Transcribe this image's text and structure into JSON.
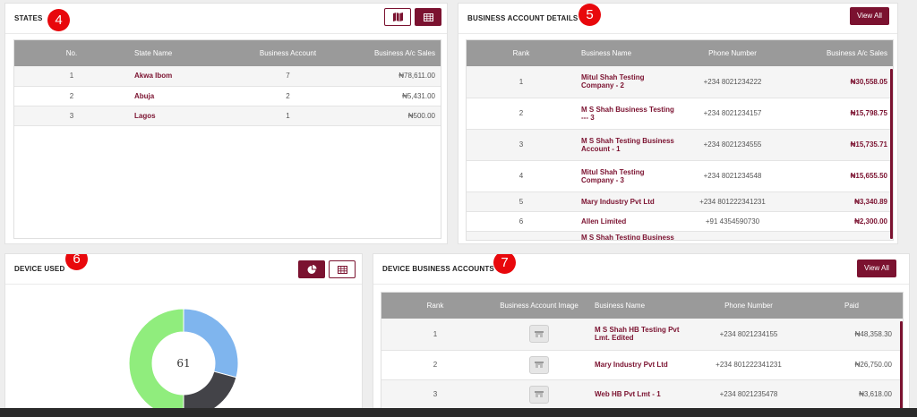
{
  "states": {
    "title": "STATES",
    "badge": "4",
    "icons": {
      "map": "map-icon",
      "table": "table-icon"
    },
    "columns": [
      "No.",
      "State Name",
      "Business Account",
      "Business A/c Sales"
    ],
    "rows": [
      {
        "no": "1",
        "name": "Akwa Ibom",
        "accounts": "7",
        "sales": "₦78,611.00"
      },
      {
        "no": "2",
        "name": "Abuja",
        "accounts": "2",
        "sales": "₦5,431.00"
      },
      {
        "no": "3",
        "name": "Lagos",
        "accounts": "1",
        "sales": "₦500.00"
      }
    ]
  },
  "business_details": {
    "title": "BUSINESS ACCOUNT DETAILS",
    "badge": "5",
    "view_all": "View All",
    "columns": [
      "Rank",
      "Business Name",
      "Phone Number",
      "Business A/c Sales"
    ],
    "rows": [
      {
        "rank": "1",
        "name": "Mitul Shah Testing Company - 2",
        "phone": "+234 8021234222",
        "sales": "₦30,558.05"
      },
      {
        "rank": "2",
        "name": "M S Shah Business Testing --- 3",
        "phone": "+234 8021234157",
        "sales": "₦15,798.75"
      },
      {
        "rank": "3",
        "name": "M S Shah Testing Business Account - 1",
        "phone": "+234 8021234555",
        "sales": "₦15,735.71"
      },
      {
        "rank": "4",
        "name": "Mitul Shah Testing Company - 3",
        "phone": "+234 8021234548",
        "sales": "₦15,655.50"
      },
      {
        "rank": "5",
        "name": "Mary Industry Pvt Ltd",
        "phone": "+234 801222341231",
        "sales": "₦3,340.89"
      },
      {
        "rank": "6",
        "name": "Allen Limited",
        "phone": "+91 4354590730",
        "sales": "₦2,300.00"
      },
      {
        "rank": "",
        "name": "M S Shah Testing Business",
        "phone": "",
        "sales": ""
      }
    ]
  },
  "device_used": {
    "title": "DEVICE USED",
    "badge": "6",
    "icons": {
      "chart": "pie-chart-icon",
      "table": "table-icon"
    },
    "center_value": "61",
    "colors": {
      "blue": "#7fb5ee",
      "dark": "#434348",
      "green": "#90ed7d"
    }
  },
  "device_accounts": {
    "title": "DEVICE BUSINESS ACCOUNTS",
    "badge": "7",
    "view_all": "View All",
    "columns": [
      "Rank",
      "Business Account Image",
      "Business Name",
      "Phone Number",
      "Paid"
    ],
    "rows": [
      {
        "rank": "1",
        "image": "store-icon",
        "name": "M S Shah HB Testing Pvt Lmt. Edited",
        "phone": "+234 8021234155",
        "paid": "₦48,358.30"
      },
      {
        "rank": "2",
        "image": "store-icon",
        "name": "Mary Industry Pvt Ltd",
        "phone": "+234 801222341231",
        "paid": "₦26,750.00"
      },
      {
        "rank": "3",
        "image": "store-icon",
        "name": "Web HB Pvt Lmt - 1",
        "phone": "+234 8021235478",
        "paid": "₦3,618.00"
      }
    ]
  },
  "theme": {
    "accent": "#7b1230",
    "badge": "#e8080c",
    "header_gray": "#9a9a9a"
  }
}
